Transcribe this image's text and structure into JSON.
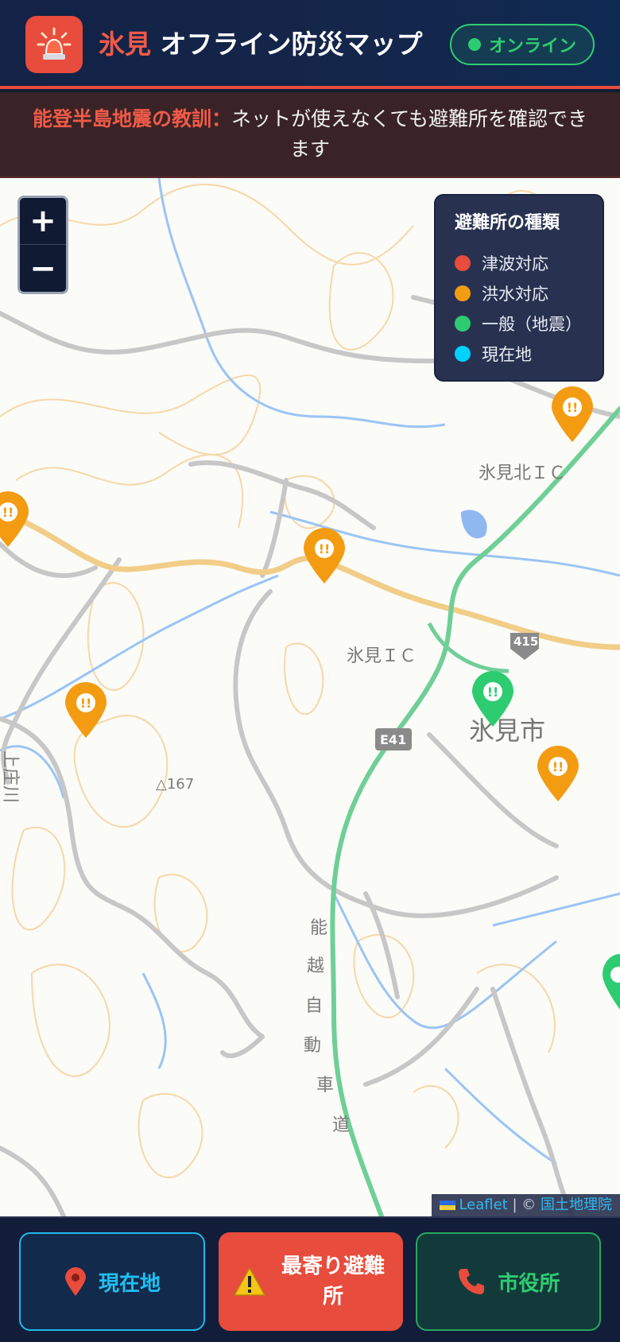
{
  "header": {
    "title_accent": "氷見",
    "title_rest": "オフライン防災マップ",
    "status_label": "オンライン",
    "status_color": "#2ecc71",
    "icon": "siren-icon"
  },
  "banner": {
    "lead": "能登半島地震の教訓：",
    "text": "ネットが使えなくても避難所を確認できます"
  },
  "map": {
    "zoom_in": "+",
    "zoom_out": "−",
    "legend": {
      "title": "避難所の種類",
      "items": [
        {
          "label": "津波対応",
          "color": "#e74c3c"
        },
        {
          "label": "洪水対応",
          "color": "#f39c12"
        },
        {
          "label": "一般（地震）",
          "color": "#2ecc71"
        },
        {
          "label": "現在地",
          "color": "#00d2ff"
        }
      ]
    },
    "labels": {
      "ic_north": "氷見北ＩＣ",
      "ic": "氷見ＩＣ",
      "city": "氷見市",
      "route_415": "415",
      "route_e41": "E41",
      "peak": "△167",
      "expressway": [
        "能",
        "越",
        "自",
        "動",
        "車",
        "道"
      ],
      "river_left": "上庄川"
    },
    "attribution": {
      "leaflet": "Leaflet",
      "separator": " | © ",
      "source": "国土地理院"
    }
  },
  "actions": {
    "current_location": {
      "label": "現在地",
      "icon": "pin-icon"
    },
    "nearest_shelter": {
      "label": "最寄り避難所",
      "icon": "warning-icon"
    },
    "city_hall": {
      "label": "市役所",
      "icon": "phone-icon"
    }
  }
}
